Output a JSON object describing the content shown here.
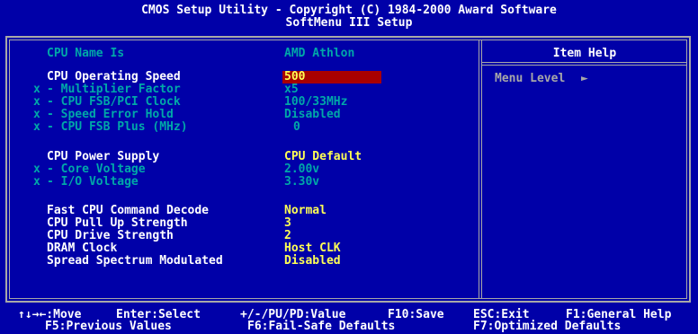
{
  "header": {
    "line1": "CMOS Setup Utility - Copyright (C) 1984-2000 Award Software",
    "line2": "SoftMenu III Setup"
  },
  "cpu_name": {
    "label": "CPU Name Is",
    "value": "AMD Athlon"
  },
  "operating_speed": {
    "label": "CPU Operating Speed",
    "value": "500"
  },
  "speed_sub": [
    {
      "prefix": "x",
      "label": "- Multiplier Factor",
      "value": "x5"
    },
    {
      "prefix": "x",
      "label": "- CPU FSB/PCI Clock",
      "value": "100/33MHz"
    },
    {
      "prefix": "x",
      "label": "- Speed Error Hold",
      "value": "Disabled"
    },
    {
      "prefix": "x",
      "label": "- CPU FSB Plus (MHz)",
      "value": "0"
    }
  ],
  "power_supply": {
    "label": "CPU Power Supply",
    "value": "CPU Default"
  },
  "power_sub": [
    {
      "prefix": "x",
      "label": "- Core Voltage",
      "value": "2.00v"
    },
    {
      "prefix": "x",
      "label": "- I/O Voltage",
      "value": "3.30v"
    }
  ],
  "misc": [
    {
      "label": "Fast CPU Command Decode",
      "value": "Normal"
    },
    {
      "label": "CPU Pull Up Strength",
      "value": "3"
    },
    {
      "label": "CPU Drive Strength",
      "value": "2"
    },
    {
      "label": "DRAM Clock",
      "value": "Host CLK"
    },
    {
      "label": "Spread Spectrum Modulated",
      "value": "Disabled"
    }
  ],
  "item_help": {
    "title": "Item Help",
    "menu_level_label": "Menu Level",
    "arrow": "►"
  },
  "footer": {
    "line1": {
      "move": "↑↓→←:Move",
      "select": "Enter:Select",
      "value": "+/-/PU/PD:Value",
      "save": "F10:Save",
      "exit": "ESC:Exit",
      "help": "F1:General Help"
    },
    "line2": {
      "previous": "F5:Previous Values",
      "failsafe": "F6:Fail-Safe Defaults",
      "optimized": "F7:Optimized Defaults"
    }
  },
  "colors": {
    "background": "#0000a8",
    "label": "#ffffff",
    "value": "#ffff55",
    "disabled": "#00a8a8",
    "highlight": "#a80000",
    "frame": "#a8a8a8"
  }
}
